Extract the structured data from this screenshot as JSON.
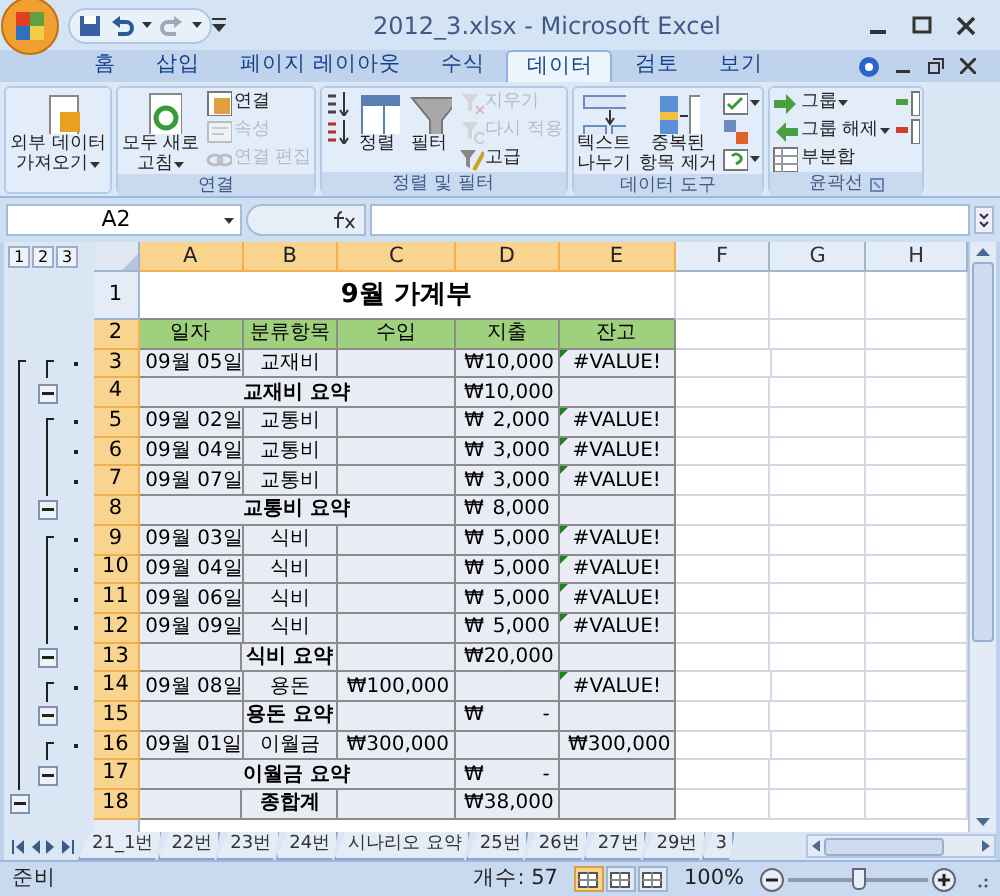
{
  "window": {
    "title": "2012_3.xlsx - Microsoft Excel"
  },
  "tabs": [
    {
      "label": "홈",
      "selected": false
    },
    {
      "label": "삽입",
      "selected": false
    },
    {
      "label": "페이지 레이아웃",
      "selected": false
    },
    {
      "label": "수식",
      "selected": false
    },
    {
      "label": "데이터",
      "selected": true
    },
    {
      "label": "검토",
      "selected": false
    },
    {
      "label": "보기",
      "selected": false
    }
  ],
  "ribbon": {
    "groups": [
      {
        "columns": [
          {
            "kind": "large",
            "lines": [
              "외부 데이터",
              "가져오기"
            ],
            "dropdown": true
          }
        ]
      },
      {
        "label": "연결",
        "columns": [
          {
            "kind": "large",
            "lines": [
              "모두 새로",
              "고침"
            ],
            "dropdown": true
          },
          {
            "kind": "stack",
            "items": [
              {
                "label": "연결",
                "disabled": false
              },
              {
                "label": "속성",
                "disabled": true
              },
              {
                "label": "연결 편집",
                "disabled": true
              }
            ]
          }
        ]
      },
      {
        "label": "정렬 및 필터",
        "columns": [
          {
            "kind": "stack",
            "items": [
              {
                "disabled": false
              },
              {
                "disabled": false
              }
            ]
          },
          {
            "kind": "large",
            "lines": [
              "정렬"
            ]
          },
          {
            "kind": "large",
            "lines": [
              "필터"
            ]
          },
          {
            "kind": "stack",
            "items": [
              {
                "label": "지우기",
                "disabled": true
              },
              {
                "label": "다시 적용",
                "disabled": true
              },
              {
                "label": "고급",
                "disabled": false
              }
            ]
          }
        ]
      },
      {
        "label": "데이터 도구",
        "columns": [
          {
            "kind": "large",
            "lines": [
              "텍스트",
              "나누기"
            ]
          },
          {
            "kind": "large",
            "lines": [
              "중복된",
              "항목 제거"
            ]
          },
          {
            "kind": "stack",
            "items": [
              {
                "disabled": false,
                "dropdown": true
              },
              {
                "disabled": false
              },
              {
                "disabled": false,
                "dropdown": true
              }
            ]
          }
        ]
      },
      {
        "label": "윤곽선",
        "launcher": true,
        "columns": [
          {
            "kind": "stack",
            "items": [
              {
                "label": "그룹",
                "disabled": false,
                "dropdown": true
              },
              {
                "label": "그룹 해제",
                "disabled": false,
                "dropdown": true
              },
              {
                "label": "부분합",
                "disabled": false
              }
            ]
          },
          {
            "kind": "stack",
            "items": [
              {
                "disabled": false
              },
              {
                "disabled": false
              }
            ]
          }
        ]
      }
    ]
  },
  "formula_bar": {
    "name_box": "A2"
  },
  "outline_levels": [
    "1",
    "2",
    "3"
  ],
  "columns": [
    {
      "label": "A",
      "selected": true
    },
    {
      "label": "B",
      "selected": true
    },
    {
      "label": "C",
      "selected": true
    },
    {
      "label": "D",
      "selected": true
    },
    {
      "label": "E",
      "selected": true
    },
    {
      "label": "F",
      "selected": false
    },
    {
      "label": "G",
      "selected": false
    },
    {
      "label": "H",
      "selected": false
    }
  ],
  "rows": [
    {
      "number": "1",
      "selected": false,
      "kind": "title",
      "title": "9월 가계부"
    },
    {
      "number": "2",
      "selected": true,
      "kind": "header",
      "cells": [
        "일자",
        "분류항목",
        "수입",
        "지출",
        "잔고"
      ]
    },
    {
      "number": "3",
      "selected": true,
      "kind": "detail",
      "outline": {
        "kind": "detail",
        "group_start": true
      },
      "date": "09월 05일",
      "category": "교재비",
      "expense": {
        "currency": "₩",
        "amount": "10,000"
      },
      "balance": {
        "text": "#VALUE!"
      },
      "flagged": true
    },
    {
      "number": "4",
      "selected": true,
      "kind": "summary",
      "merged": true,
      "outline": {
        "kind": "group_end"
      },
      "label": "교재비 요약",
      "expense": {
        "currency": "₩",
        "amount": "10,000"
      }
    },
    {
      "number": "5",
      "selected": true,
      "kind": "detail",
      "outline": {
        "kind": "detail",
        "group_start": true
      },
      "date": "09월 02일",
      "category": "교통비",
      "expense": {
        "currency": "₩",
        "amount": "2,000"
      },
      "balance": {
        "text": "#VALUE!"
      },
      "flagged": true
    },
    {
      "number": "6",
      "selected": true,
      "kind": "detail",
      "outline": {
        "kind": "detail",
        "group_start": false
      },
      "date": "09월 04일",
      "category": "교통비",
      "expense": {
        "currency": "₩",
        "amount": "3,000"
      },
      "balance": {
        "text": "#VALUE!"
      },
      "flagged": true
    },
    {
      "number": "7",
      "selected": true,
      "kind": "detail",
      "outline": {
        "kind": "detail",
        "group_start": false
      },
      "date": "09월 07일",
      "category": "교통비",
      "expense": {
        "currency": "₩",
        "amount": "3,000"
      },
      "balance": {
        "text": "#VALUE!"
      },
      "flagged": true
    },
    {
      "number": "8",
      "selected": true,
      "kind": "summary",
      "merged": true,
      "outline": {
        "kind": "group_end"
      },
      "label": "교통비 요약",
      "expense": {
        "currency": "₩",
        "amount": "8,000"
      }
    },
    {
      "number": "9",
      "selected": true,
      "kind": "detail",
      "outline": {
        "kind": "detail",
        "group_start": true
      },
      "date": "09월 03일",
      "category": "식비",
      "expense": {
        "currency": "₩",
        "amount": "5,000"
      },
      "balance": {
        "text": "#VALUE!"
      },
      "flagged": true
    },
    {
      "number": "10",
      "selected": true,
      "kind": "detail",
      "outline": {
        "kind": "detail",
        "group_start": false
      },
      "date": "09월 04일",
      "category": "식비",
      "expense": {
        "currency": "₩",
        "amount": "5,000"
      },
      "balance": {
        "text": "#VALUE!"
      },
      "flagged": true
    },
    {
      "number": "11",
      "selected": true,
      "kind": "detail",
      "outline": {
        "kind": "detail",
        "group_start": false
      },
      "date": "09월 06일",
      "category": "식비",
      "expense": {
        "currency": "₩",
        "amount": "5,000"
      },
      "balance": {
        "text": "#VALUE!"
      },
      "flagged": true
    },
    {
      "number": "12",
      "selected": true,
      "kind": "detail",
      "outline": {
        "kind": "detail",
        "group_start": false
      },
      "date": "09월 09일",
      "category": "식비",
      "expense": {
        "currency": "₩",
        "amount": "5,000"
      },
      "balance": {
        "text": "#VALUE!"
      },
      "flagged": true
    },
    {
      "number": "13",
      "selected": true,
      "kind": "summary",
      "merged": false,
      "outline": {
        "kind": "group_end"
      },
      "label": "식비 요약",
      "expense": {
        "currency": "₩",
        "amount": "20,000"
      }
    },
    {
      "number": "14",
      "selected": true,
      "kind": "detail",
      "outline": {
        "kind": "detail",
        "group_start": true
      },
      "date": "09월 08일",
      "category": "용돈",
      "income": {
        "currency": "₩",
        "amount": "100,000"
      },
      "balance": {
        "text": "#VALUE!"
      },
      "flagged": true
    },
    {
      "number": "15",
      "selected": true,
      "kind": "summary",
      "merged": false,
      "outline": {
        "kind": "group_end"
      },
      "label": "용돈 요약",
      "expense": {
        "currency": "₩",
        "amount": "-"
      }
    },
    {
      "number": "16",
      "selected": true,
      "kind": "detail",
      "outline": {
        "kind": "detail",
        "group_start": true
      },
      "date": "09월 01일",
      "category": "이월금",
      "income": {
        "currency": "₩",
        "amount": "300,000"
      },
      "balance": {
        "currency": "₩",
        "amount": "300,000"
      },
      "flagged": false
    },
    {
      "number": "17",
      "selected": true,
      "kind": "summary",
      "merged": true,
      "outline": {
        "kind": "group_end"
      },
      "label": "이월금 요약",
      "expense": {
        "currency": "₩",
        "amount": "-"
      }
    },
    {
      "number": "18",
      "selected": true,
      "kind": "summary",
      "merged": false,
      "outline": {
        "kind": "total_end"
      },
      "label": "종합계",
      "expense": {
        "currency": "₩",
        "amount": "38,000"
      }
    }
  ],
  "sheet_tabs": [
    {
      "label": "21_1번",
      "selected": false
    },
    {
      "label": "22번",
      "selected": false
    },
    {
      "label": "23번",
      "selected": false
    },
    {
      "label": "24번",
      "selected": false
    },
    {
      "label": "시나리오 요약",
      "selected": false
    },
    {
      "label": "25번",
      "selected": false
    },
    {
      "label": "26번",
      "selected": false
    },
    {
      "label": "27번",
      "selected": false
    },
    {
      "label": "29번",
      "selected": false
    },
    {
      "label": "3",
      "selected": false
    }
  ],
  "status_bar": {
    "mode": "준비",
    "count": "개수: 57",
    "views": [
      {
        "selected": true
      },
      {
        "selected": false
      },
      {
        "selected": false
      }
    ],
    "zoom": "100%",
    "zoom_slider": {
      "level": 0.5
    }
  }
}
